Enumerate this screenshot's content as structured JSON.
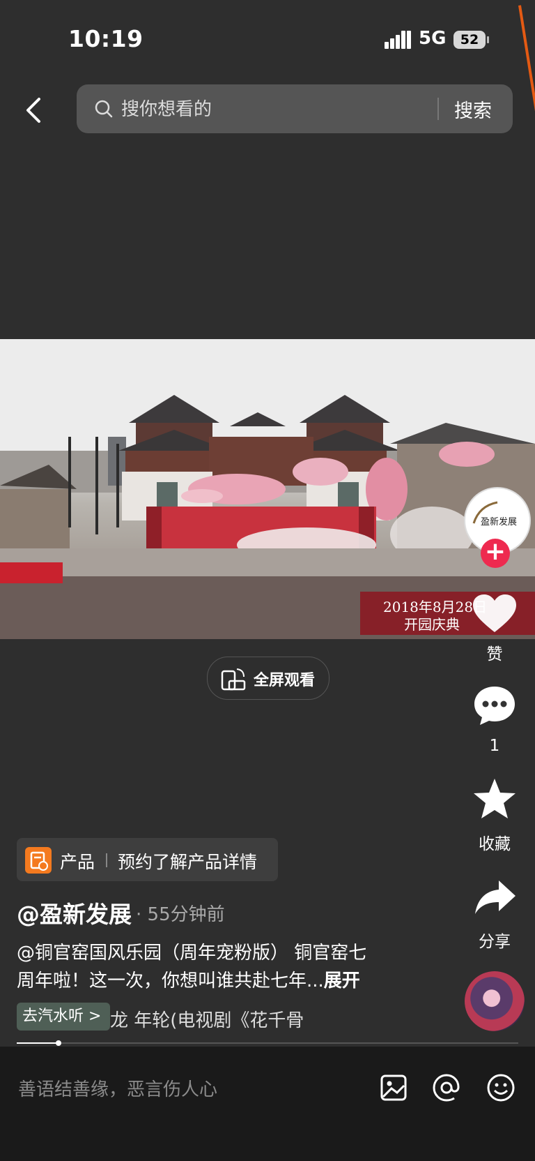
{
  "status": {
    "time": "10:19",
    "network": "5G",
    "battery": "52"
  },
  "search": {
    "placeholder": "搜你想看的",
    "button": "搜索"
  },
  "video": {
    "overlay_line1": "2018年8月28日",
    "overlay_line2": "开园庆典",
    "brand_logo_text": "盈新发展",
    "fullscreen_label": "全屏观看"
  },
  "rail": {
    "like_label": "赞",
    "comment_count": "1",
    "favorite_label": "收藏",
    "share_label": "分享"
  },
  "product": {
    "tag": "产品",
    "detail": "预约了解产品详情"
  },
  "post": {
    "author": "@盈新发展",
    "time_ago": "· 55分钟前",
    "desc_line1": "@铜官窑国风乐园（周年宠粉版） 铜官窑七",
    "desc_line2": "周年啦！这一次，你想叫谁共赴七年...",
    "expand": "展开"
  },
  "music": {
    "tag": "去汽水听 >",
    "song": "龙    年轮(电视剧《花千骨"
  },
  "comment_bar": {
    "placeholder": "善语结善缘，恶言伤人心"
  },
  "colors": {
    "background": "#2e2e2e",
    "accent_red": "#ee2a4f",
    "product_orange": "#f47a1f"
  }
}
